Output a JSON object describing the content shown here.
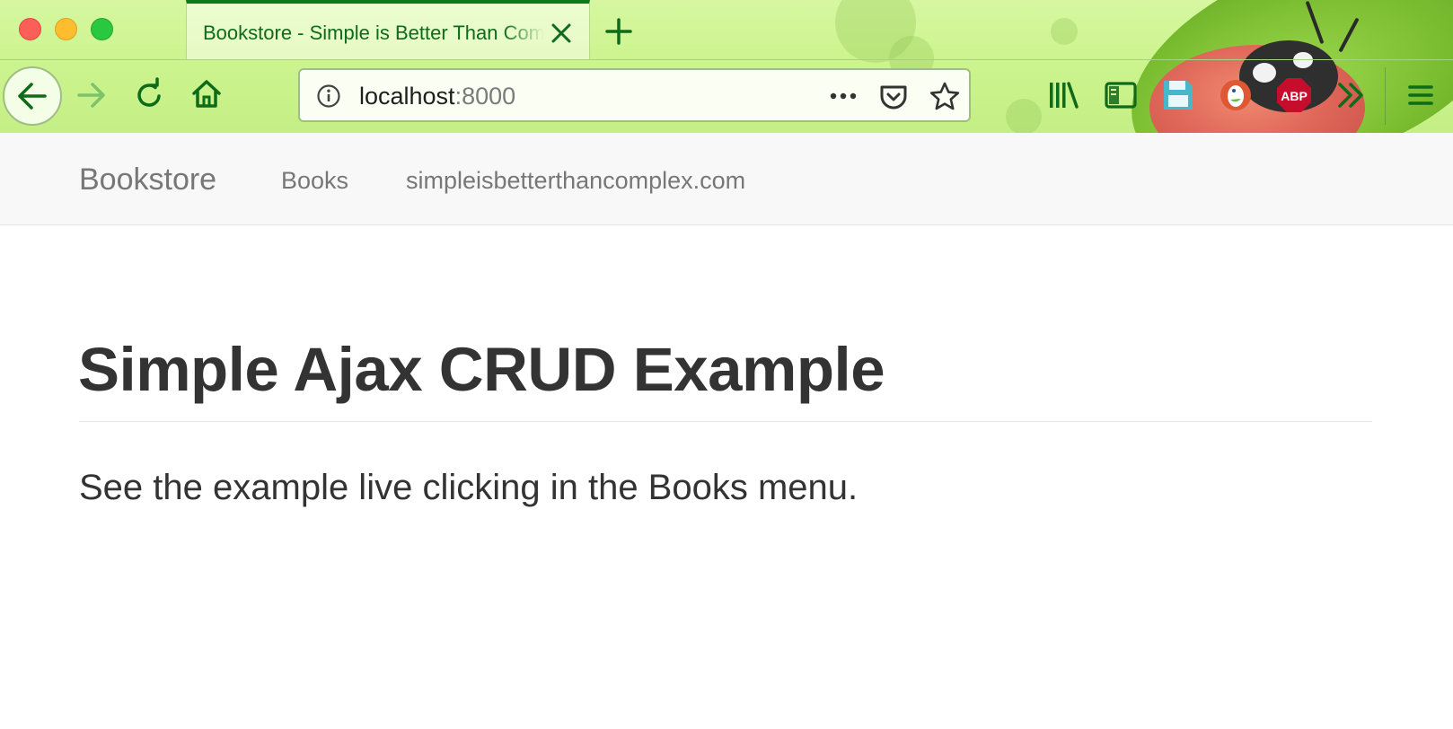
{
  "browser": {
    "tab_title": "Bookstore - Simple is Better Than Complex",
    "url_host": "localhost",
    "url_port": ":8000",
    "theme_accent": "#0b7a1a"
  },
  "page": {
    "brand": "Bookstore",
    "nav_links": [
      "Books",
      "simpleisbetterthancomplex.com"
    ],
    "title": "Simple Ajax CRUD Example",
    "lead": "See the example live clicking in the Books menu."
  },
  "icons": [
    "back-arrow-icon",
    "forward-arrow-icon",
    "reload-icon",
    "home-icon",
    "site-info-icon",
    "page-actions-icon",
    "pocket-icon",
    "bookmark-star-icon",
    "library-icon",
    "sidebar-icon",
    "save-icon",
    "duckduckgo-icon",
    "adblock-plus-icon",
    "overflow-chevron-icon",
    "menu-icon"
  ]
}
